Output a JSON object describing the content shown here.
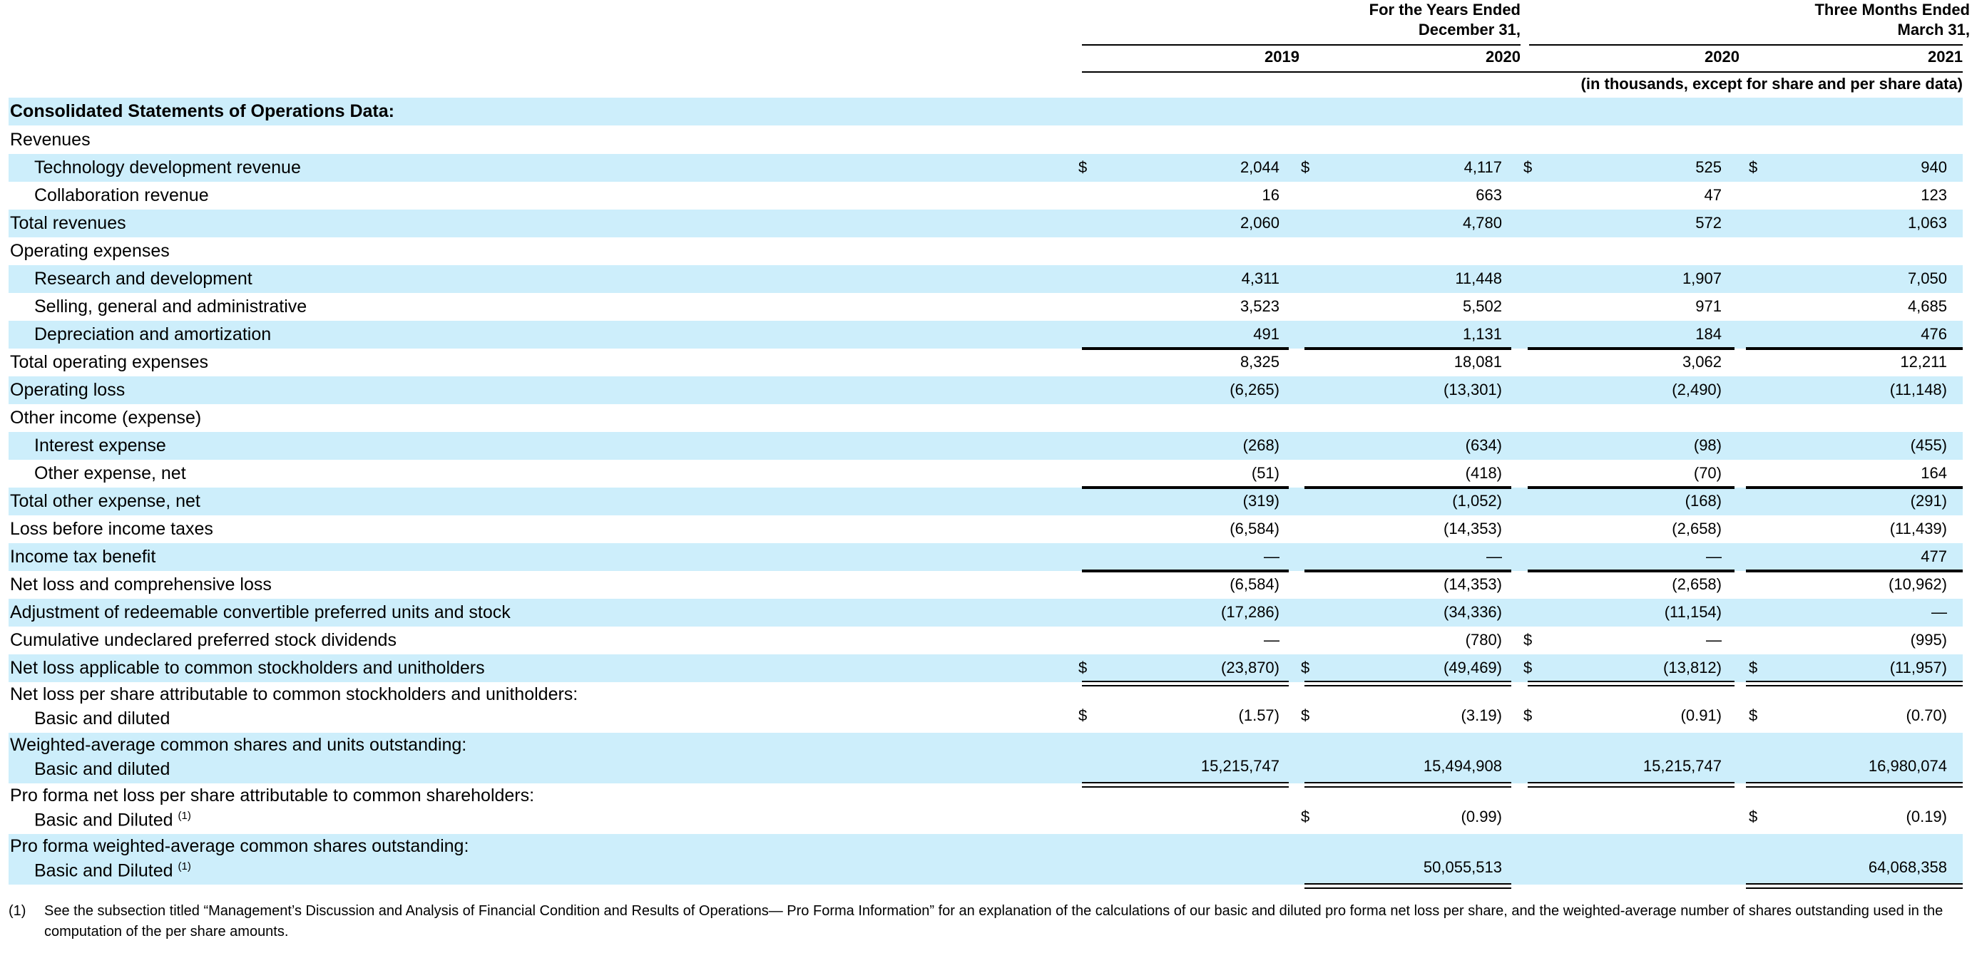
{
  "header": {
    "years_group": "For the Years Ended\nDecember 31,",
    "months_group": "Three Months Ended\nMarch 31,",
    "years": [
      "2019",
      "2020",
      "2020",
      "2021"
    ],
    "units_note": "(in thousands, except for share and per share data)"
  },
  "section_title": "Consolidated Statements of Operations Data:",
  "rows": [
    {
      "label": "Revenues",
      "sub": "",
      "values": [
        "",
        "",
        "",
        ""
      ],
      "dollar": [
        false,
        false,
        false,
        false
      ]
    },
    {
      "label": "Technology development revenue",
      "sub": "",
      "values": [
        "2,044",
        "4,117",
        "525",
        "940"
      ],
      "dollar": [
        true,
        true,
        true,
        true
      ]
    },
    {
      "label": "Collaboration revenue",
      "sub": "",
      "values": [
        "16",
        "663",
        "47",
        "123"
      ],
      "dollar": [
        false,
        false,
        false,
        false
      ]
    },
    {
      "label": "Total revenues",
      "sub": "",
      "values": [
        "2,060",
        "4,780",
        "572",
        "1,063"
      ],
      "dollar": [
        false,
        false,
        false,
        false
      ]
    },
    {
      "label": "Operating expenses",
      "sub": "",
      "values": [
        "",
        "",
        "",
        ""
      ],
      "dollar": [
        false,
        false,
        false,
        false
      ]
    },
    {
      "label": "Research and development",
      "sub": "",
      "values": [
        "4,311",
        "11,448",
        "1,907",
        "7,050"
      ],
      "dollar": [
        false,
        false,
        false,
        false
      ]
    },
    {
      "label": "Selling, general and administrative",
      "sub": "",
      "values": [
        "3,523",
        "5,502",
        "971",
        "4,685"
      ],
      "dollar": [
        false,
        false,
        false,
        false
      ]
    },
    {
      "label": "Depreciation and amortization",
      "sub": "",
      "values": [
        "491",
        "1,131",
        "184",
        "476"
      ],
      "dollar": [
        false,
        false,
        false,
        false
      ]
    },
    {
      "label": "Total operating expenses",
      "sub": "",
      "values": [
        "8,325",
        "18,081",
        "3,062",
        "12,211"
      ],
      "dollar": [
        false,
        false,
        false,
        false
      ]
    },
    {
      "label": "Operating loss",
      "sub": "",
      "values": [
        "(6,265)",
        "(13,301)",
        "(2,490)",
        "(11,148)"
      ],
      "dollar": [
        false,
        false,
        false,
        false
      ]
    },
    {
      "label": "Other income (expense)",
      "sub": "",
      "values": [
        "",
        "",
        "",
        ""
      ],
      "dollar": [
        false,
        false,
        false,
        false
      ]
    },
    {
      "label": "Interest expense",
      "sub": "",
      "values": [
        "(268)",
        "(634)",
        "(98)",
        "(455)"
      ],
      "dollar": [
        false,
        false,
        false,
        false
      ]
    },
    {
      "label": "Other expense, net",
      "sub": "",
      "values": [
        "(51)",
        "(418)",
        "(70)",
        "164"
      ],
      "dollar": [
        false,
        false,
        false,
        false
      ]
    },
    {
      "label": "Total other expense, net",
      "sub": "",
      "values": [
        "(319)",
        "(1,052)",
        "(168)",
        "(291)"
      ],
      "dollar": [
        false,
        false,
        false,
        false
      ]
    },
    {
      "label": "Loss before income taxes",
      "sub": "",
      "values": [
        "(6,584)",
        "(14,353)",
        "(2,658)",
        "(11,439)"
      ],
      "dollar": [
        false,
        false,
        false,
        false
      ]
    },
    {
      "label": "Income tax benefit",
      "sub": "",
      "values": [
        "—",
        "—",
        "—",
        "477"
      ],
      "dollar": [
        false,
        false,
        false,
        false
      ]
    },
    {
      "label": "Net loss and comprehensive loss",
      "sub": "",
      "values": [
        "(6,584)",
        "(14,353)",
        "(2,658)",
        "(10,962)"
      ],
      "dollar": [
        false,
        false,
        false,
        false
      ]
    },
    {
      "label": "Adjustment of redeemable convertible preferred units and stock",
      "sub": "",
      "values": [
        "(17,286)",
        "(34,336)",
        "(11,154)",
        "—"
      ],
      "dollar": [
        false,
        false,
        false,
        false
      ]
    },
    {
      "label": "Cumulative undeclared preferred stock dividends",
      "sub": "",
      "values": [
        "—",
        "(780)",
        "—",
        "(995)"
      ],
      "dollar": [
        false,
        false,
        true,
        false
      ]
    },
    {
      "label": "Net loss applicable to common stockholders and unitholders",
      "sub": "",
      "values": [
        "(23,870)",
        "(49,469)",
        "(13,812)",
        "(11,957)"
      ],
      "dollar": [
        true,
        true,
        true,
        true
      ]
    },
    {
      "label": "Net loss per share attributable to common stockholders and unitholders:",
      "sub": "Basic and diluted",
      "values": [
        "(1.57)",
        "(3.19)",
        "(0.91)",
        "(0.70)"
      ],
      "dollar": [
        true,
        true,
        true,
        true
      ]
    },
    {
      "label": "Weighted-average common shares and units outstanding:",
      "sub": "Basic and diluted",
      "values": [
        "15,215,747",
        "15,494,908",
        "15,215,747",
        "16,980,074"
      ],
      "dollar": [
        false,
        false,
        false,
        false
      ]
    },
    {
      "label": "Pro forma net loss per share attributable to common shareholders:",
      "sub": "Basic and Diluted",
      "values": [
        "",
        "(0.99)",
        "",
        "(0.19)"
      ],
      "dollar": [
        false,
        true,
        false,
        true
      ]
    },
    {
      "label": "Pro forma weighted-average common shares outstanding:",
      "sub": "Basic and Diluted",
      "values": [
        "",
        "50,055,513",
        "",
        "64,068,358"
      ],
      "dollar": [
        false,
        false,
        false,
        false
      ]
    }
  ],
  "footnote_marker": "(1)",
  "footnote": "(1)",
  "footnote_text": "See the subsection titled “Management’s Discussion and Analysis of Financial Condition and Results of Operations— Pro Forma Information” for an explanation of the calculations of our basic and diluted pro forma net loss per share, and the weighted-average number of shares outstanding used in the computation of the per share amounts.",
  "currency_symbol": "$",
  "colors": {
    "row_shade": "#cdeefb"
  }
}
